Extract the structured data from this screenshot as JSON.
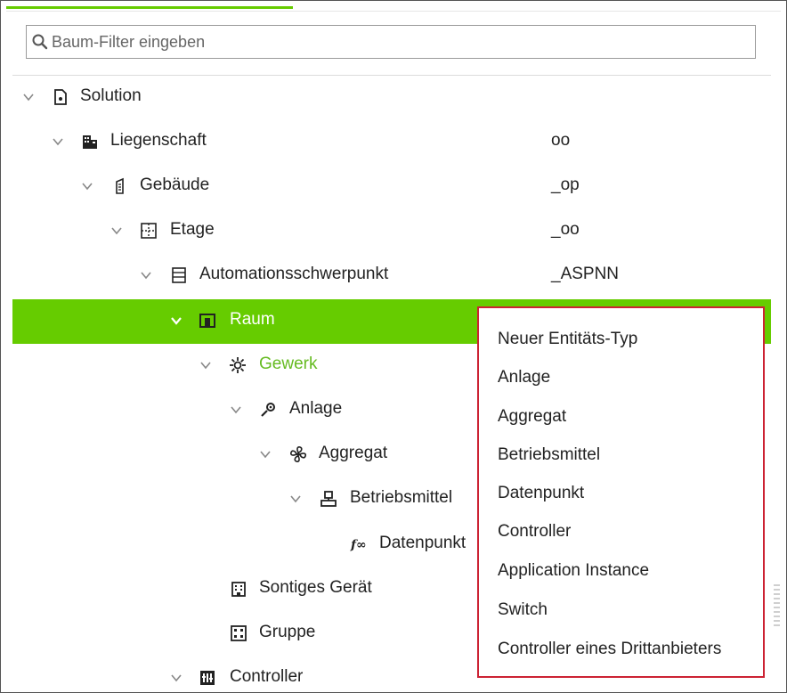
{
  "search": {
    "placeholder": "Baum-Filter eingeben"
  },
  "tree": [
    {
      "label": "Solution",
      "value": "",
      "icon": "solution-icon"
    },
    {
      "label": "Liegenschaft",
      "value": "oo",
      "icon": "property-icon"
    },
    {
      "label": "Gebäude",
      "value": "_op",
      "icon": "building-icon"
    },
    {
      "label": "Etage",
      "value": "_oo",
      "icon": "floor-icon"
    },
    {
      "label": "Automationsschwerpunkt",
      "value": "_ASPNN",
      "icon": "automation-center-icon"
    },
    {
      "label": "Raum",
      "value": "",
      "icon": "room-icon",
      "selected": true
    },
    {
      "label": "Gewerk",
      "value": "",
      "icon": "trade-icon"
    },
    {
      "label": "Anlage",
      "value": "",
      "icon": "plant-icon"
    },
    {
      "label": "Aggregat",
      "value": "",
      "icon": "fan-icon"
    },
    {
      "label": "Betriebsmittel",
      "value": "",
      "icon": "equipment-icon"
    },
    {
      "label": "Datenpunkt",
      "value": "",
      "icon": "function-icon"
    },
    {
      "label": "Sontiges Gerät",
      "value": "",
      "icon": "device-icon"
    },
    {
      "label": "Gruppe",
      "value": "",
      "icon": "group-icon"
    },
    {
      "label": "Controller",
      "value": "",
      "icon": "controller-icon"
    }
  ],
  "context_menu": {
    "items": [
      "Neuer Entitäts-Typ",
      "Anlage",
      "Aggregat",
      "Betriebsmittel",
      "Datenpunkt",
      "Controller",
      "Application Instance",
      "Switch",
      "Controller eines Drittanbieters"
    ]
  },
  "colors": {
    "accent": "#66cc00",
    "menu_border": "#cc2233"
  }
}
